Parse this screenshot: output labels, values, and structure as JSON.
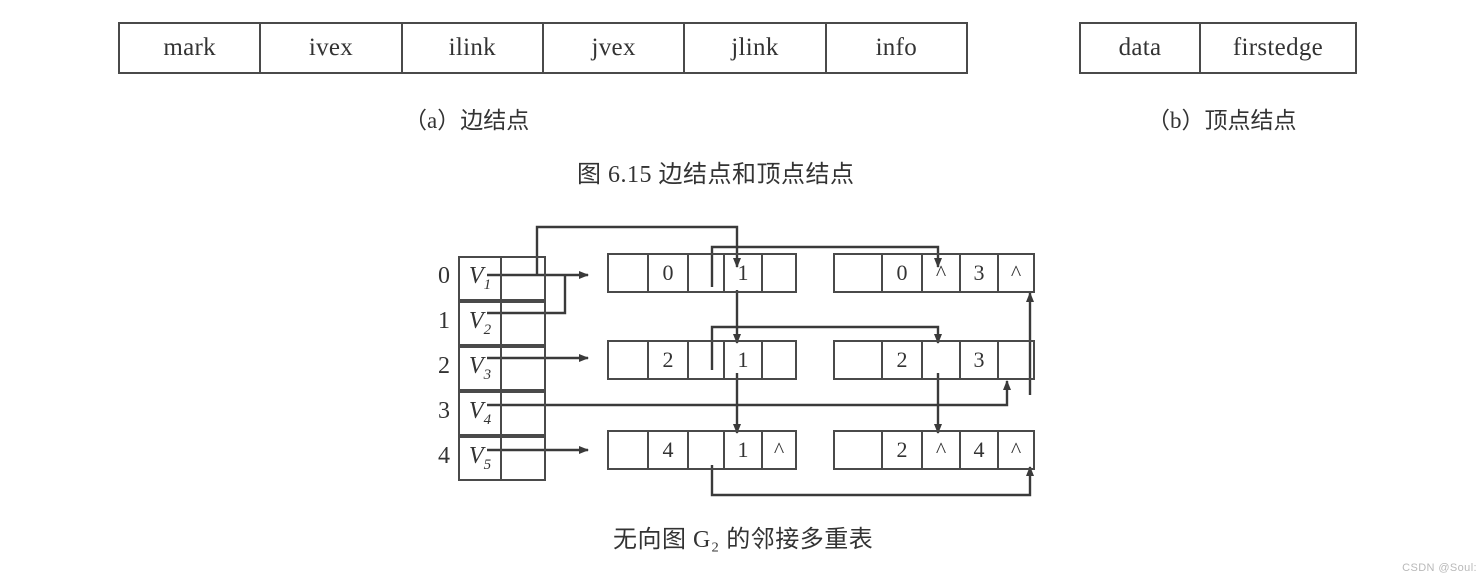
{
  "figure": {
    "edge_node_format": {
      "name": "edge-node-format",
      "cells": [
        "mark",
        "ivex",
        "ilink",
        "jvex",
        "jlink",
        "info"
      ],
      "caption": "（a）边结点"
    },
    "vertex_node_format": {
      "name": "vertex-node-format",
      "cells": [
        "data",
        "firstedge"
      ],
      "caption": "（b）顶点结点"
    },
    "figure_caption": "图 6.15   边结点和顶点结点"
  },
  "diagram": {
    "caption": "无向图 G₂ 的邻接多重表",
    "vertex_array": [
      {
        "index": "0",
        "data": "V",
        "sub": "1"
      },
      {
        "index": "1",
        "data": "V",
        "sub": "2"
      },
      {
        "index": "2",
        "data": "V",
        "sub": "3"
      },
      {
        "index": "3",
        "data": "V",
        "sub": "4"
      },
      {
        "index": "4",
        "data": "V",
        "sub": "5"
      }
    ],
    "edge_rows": [
      {
        "row": "0",
        "nodes": [
          {
            "cells": [
              "",
              "0",
              "",
              "1",
              ""
            ]
          },
          {
            "cells": [
              "",
              "0",
              "^",
              "3",
              "^"
            ]
          }
        ]
      },
      {
        "row": "1",
        "nodes": [
          {
            "cells": [
              "",
              "2",
              "",
              "1",
              ""
            ]
          },
          {
            "cells": [
              "",
              "2",
              "",
              "3",
              ""
            ]
          }
        ]
      },
      {
        "row": "2",
        "nodes": [
          {
            "cells": [
              "",
              "4",
              "",
              "1",
              "^"
            ]
          },
          {
            "cells": [
              "",
              "2",
              "^",
              "4",
              "^"
            ]
          }
        ]
      }
    ]
  },
  "watermark": "CSDN @Soul:",
  "colors": {
    "line": "#4a4a4a",
    "text": "#333333",
    "background": "#ffffff"
  }
}
